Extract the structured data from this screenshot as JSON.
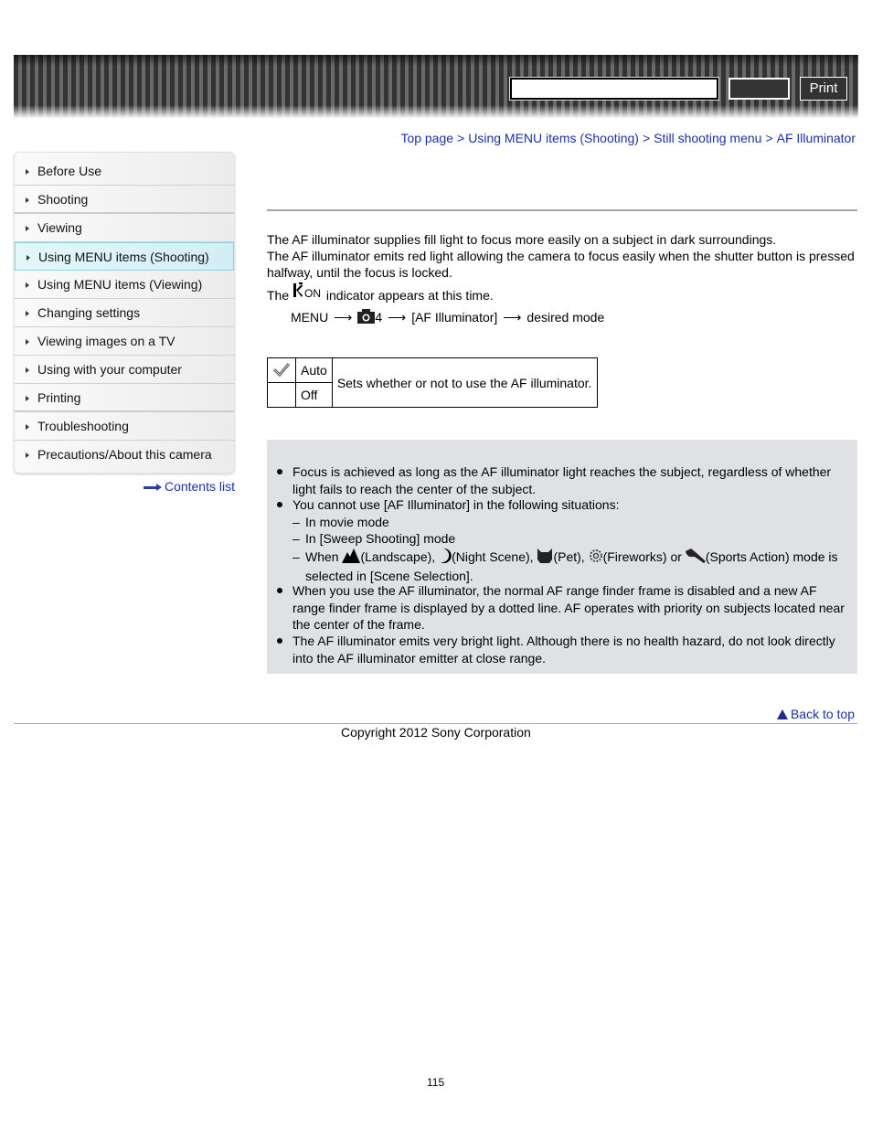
{
  "header": {
    "search_placeholder": "",
    "search_button_label": "",
    "print_label": "Print"
  },
  "breadcrumb": [
    {
      "label": "Top page"
    },
    {
      "label": "Using MENU items (Shooting)"
    },
    {
      "label": "Still shooting menu"
    },
    {
      "label": "AF Illuminator"
    }
  ],
  "breadcrumb_separator": ">",
  "sidebar": {
    "items": [
      {
        "label": "Before Use",
        "active": false
      },
      {
        "label": "Shooting",
        "active": false
      },
      {
        "label": "Viewing",
        "active": false
      },
      {
        "label": "Using MENU items (Shooting)",
        "active": true
      },
      {
        "label": "Using MENU items (Viewing)",
        "active": false
      },
      {
        "label": "Changing settings",
        "active": false
      },
      {
        "label": "Viewing images on a TV",
        "active": false
      },
      {
        "label": "Using with your computer",
        "active": false
      },
      {
        "label": "Printing",
        "active": false
      },
      {
        "label": "Troubleshooting",
        "active": false
      },
      {
        "label": "Precautions/About this camera",
        "active": false
      }
    ],
    "contents_list_label": "Contents list"
  },
  "main": {
    "intro_line1": "The AF illuminator supplies fill light to focus more easily on a subject in dark surroundings.",
    "intro_line2": "The AF illuminator emits red light allowing the camera to focus easily when the shutter button is pressed halfway, until the focus is locked.",
    "indicator_prefix": "The",
    "indicator_suffix": "indicator appears at this time.",
    "indicator_icon_text": "ON",
    "menu_path": {
      "menu": "MENU",
      "tab_number": "4",
      "item": "[AF Illuminator]",
      "end": "desired mode",
      "arrow": "⟶"
    },
    "options_table": {
      "rows": [
        {
          "default": true,
          "label": "Auto"
        },
        {
          "default": false,
          "label": "Off"
        }
      ],
      "description": "Sets whether or not to use the AF illuminator."
    },
    "notes": {
      "note1": "Focus is achieved as long as the AF illuminator light reaches the subject, regardless of whether light fails to reach the center of the subject.",
      "note2": "You cannot use [AF Illuminator] in the following situations:",
      "sub1": "In movie mode",
      "sub2": "In [Sweep Shooting] mode",
      "sub3_when": "When",
      "sub3_landscape": "(Landscape),",
      "sub3_night": "(Night Scene),",
      "sub3_pet": "(Pet),",
      "sub3_fireworks": "(Fireworks) or",
      "sub3_sports": "(Sports Action) mode is selected in [Scene Selection].",
      "note3": "When you use the AF illuminator, the normal AF range finder frame is disabled and a new AF range finder frame is displayed by a dotted line. AF operates with priority on subjects located near the center of the frame.",
      "note4": "The AF illuminator emits very bright light. Although there is no health hazard, do not look directly into the AF illuminator emitter at close range.",
      "dash": "–"
    },
    "back_to_top": "Back to top"
  },
  "footer": {
    "copyright": "Copyright 2012 Sony Corporation",
    "page_number": "115"
  }
}
